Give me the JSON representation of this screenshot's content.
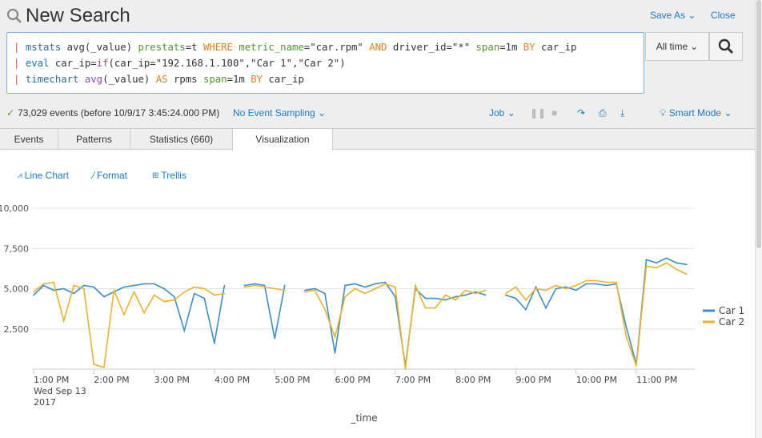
{
  "header": {
    "title": "New Search",
    "save_as": "Save As",
    "close": "Close"
  },
  "search": {
    "lines": [
      [
        {
          "t": "| ",
          "k": "pipe"
        },
        {
          "t": "mstats ",
          "k": "cmd"
        },
        {
          "t": "avg(_value) ",
          "k": "plain"
        },
        {
          "t": "prestats",
          "k": "arg"
        },
        {
          "t": "=t ",
          "k": "plain"
        },
        {
          "t": "WHERE ",
          "k": "kw"
        },
        {
          "t": "metric_name",
          "k": "arg"
        },
        {
          "t": "=\"car.rpm\" ",
          "k": "plain"
        },
        {
          "t": "AND ",
          "k": "kw"
        },
        {
          "t": "driver_id=\"*\" ",
          "k": "plain"
        },
        {
          "t": "span",
          "k": "arg"
        },
        {
          "t": "=1m ",
          "k": "plain"
        },
        {
          "t": "BY ",
          "k": "kw"
        },
        {
          "t": "car_ip",
          "k": "plain"
        }
      ],
      [
        {
          "t": "| ",
          "k": "pipe"
        },
        {
          "t": "eval ",
          "k": "cmd"
        },
        {
          "t": "car_ip=",
          "k": "plain"
        },
        {
          "t": "if",
          "k": "fn"
        },
        {
          "t": "(car_ip=\"192.168.1.100\",\"Car 1\",\"Car 2\")",
          "k": "plain"
        }
      ],
      [
        {
          "t": "| ",
          "k": "pipe"
        },
        {
          "t": "timechart ",
          "k": "cmd"
        },
        {
          "t": "avg",
          "k": "fn"
        },
        {
          "t": "(_value) ",
          "k": "plain"
        },
        {
          "t": "AS ",
          "k": "kw"
        },
        {
          "t": "rpms ",
          "k": "plain"
        },
        {
          "t": "span",
          "k": "arg"
        },
        {
          "t": "=1m ",
          "k": "plain"
        },
        {
          "t": "BY ",
          "k": "kw"
        },
        {
          "t": "car_ip",
          "k": "plain"
        }
      ]
    ],
    "time_range": "All time"
  },
  "status": {
    "events": "73,029 events (before 10/9/17 3:45:24.000 PM)",
    "sampling": "No Event Sampling",
    "job": "Job",
    "mode": "Smart Mode"
  },
  "tabs": [
    {
      "label": "Events"
    },
    {
      "label": "Patterns"
    },
    {
      "label": "Statistics (660)"
    },
    {
      "label": "Visualization",
      "active": true
    }
  ],
  "viz": {
    "chart_type": "Line Chart",
    "format": "Format",
    "trellis": "Trellis"
  },
  "colors": {
    "car1": "#3c8ec8",
    "car2": "#ecb32a",
    "link": "#1a7bc4"
  },
  "chart_data": {
    "type": "line",
    "xlabel": "_time",
    "ylabel": "",
    "ylim": [
      0,
      10000
    ],
    "grid": true,
    "legend": "right",
    "yticks": [
      "2,500",
      "5,000",
      "7,500",
      "10,000"
    ],
    "xticks": [
      "1:00 PM",
      "2:00 PM",
      "3:00 PM",
      "4:00 PM",
      "5:00 PM",
      "6:00 PM",
      "7:00 PM",
      "8:00 PM",
      "9:00 PM",
      "10:00 PM",
      "11:00 PM"
    ],
    "xtick_sub": [
      "Wed Sep 13",
      "2017"
    ],
    "x": [
      "13:00",
      "13:10",
      "13:20",
      "13:30",
      "13:40",
      "13:50",
      "14:00",
      "14:10",
      "14:20",
      "14:30",
      "14:40",
      "14:50",
      "15:00",
      "15:10",
      "15:20",
      "15:30",
      "15:40",
      "15:50",
      "16:00",
      "16:10",
      "16:20",
      "16:30",
      "16:40",
      "16:50",
      "17:00",
      "17:10",
      "17:20",
      "17:30",
      "17:40",
      "17:50",
      "18:00",
      "18:10",
      "18:20",
      "18:30",
      "18:40",
      "18:50",
      "19:00",
      "19:10",
      "19:20",
      "19:30",
      "19:40",
      "19:50",
      "20:00",
      "20:10",
      "20:20",
      "20:30",
      "20:40",
      "20:50",
      "21:00",
      "21:10",
      "21:20",
      "21:30",
      "21:40",
      "21:50",
      "22:00",
      "22:10",
      "22:20",
      "22:30",
      "22:40",
      "22:50",
      "23:00",
      "23:10",
      "23:20",
      "23:30",
      "23:40",
      "23:50"
    ],
    "series": [
      {
        "name": "Car 1",
        "values": [
          4600,
          5200,
          4900,
          5000,
          4700,
          5200,
          5100,
          4500,
          4800,
          5100,
          5200,
          5300,
          5300,
          5000,
          4500,
          2400,
          4700,
          4400,
          1600,
          5200,
          null,
          5200,
          5300,
          5200,
          1900,
          5200,
          null,
          4900,
          5000,
          4700,
          1000,
          5200,
          5300,
          5100,
          5300,
          5400,
          4500,
          200,
          5000,
          4400,
          4400,
          4300,
          4500,
          4600,
          4800,
          4600,
          null,
          4600,
          4400,
          3700,
          5100,
          3800,
          5000,
          5100,
          4900,
          5300,
          5300,
          5200,
          5300,
          2600,
          300,
          6800,
          6600,
          6900,
          6600,
          6500
        ]
      },
      {
        "name": "Car 2",
        "values": [
          4800,
          5300,
          5400,
          3000,
          5200,
          5000,
          300,
          100,
          4900,
          3400,
          4800,
          3500,
          4600,
          4200,
          4300,
          4800,
          5100,
          5000,
          4600,
          4700,
          null,
          5100,
          5200,
          5100,
          5000,
          4900,
          null,
          4800,
          4900,
          3700,
          2000,
          4500,
          5000,
          4700,
          5000,
          5300,
          5100,
          0,
          5200,
          3800,
          3800,
          4600,
          4300,
          4900,
          4700,
          4900,
          null,
          4700,
          5100,
          4300,
          5000,
          4900,
          5200,
          5000,
          5200,
          5500,
          5500,
          5400,
          5400,
          2000,
          200,
          6400,
          6300,
          6600,
          6200,
          5900
        ]
      }
    ]
  }
}
